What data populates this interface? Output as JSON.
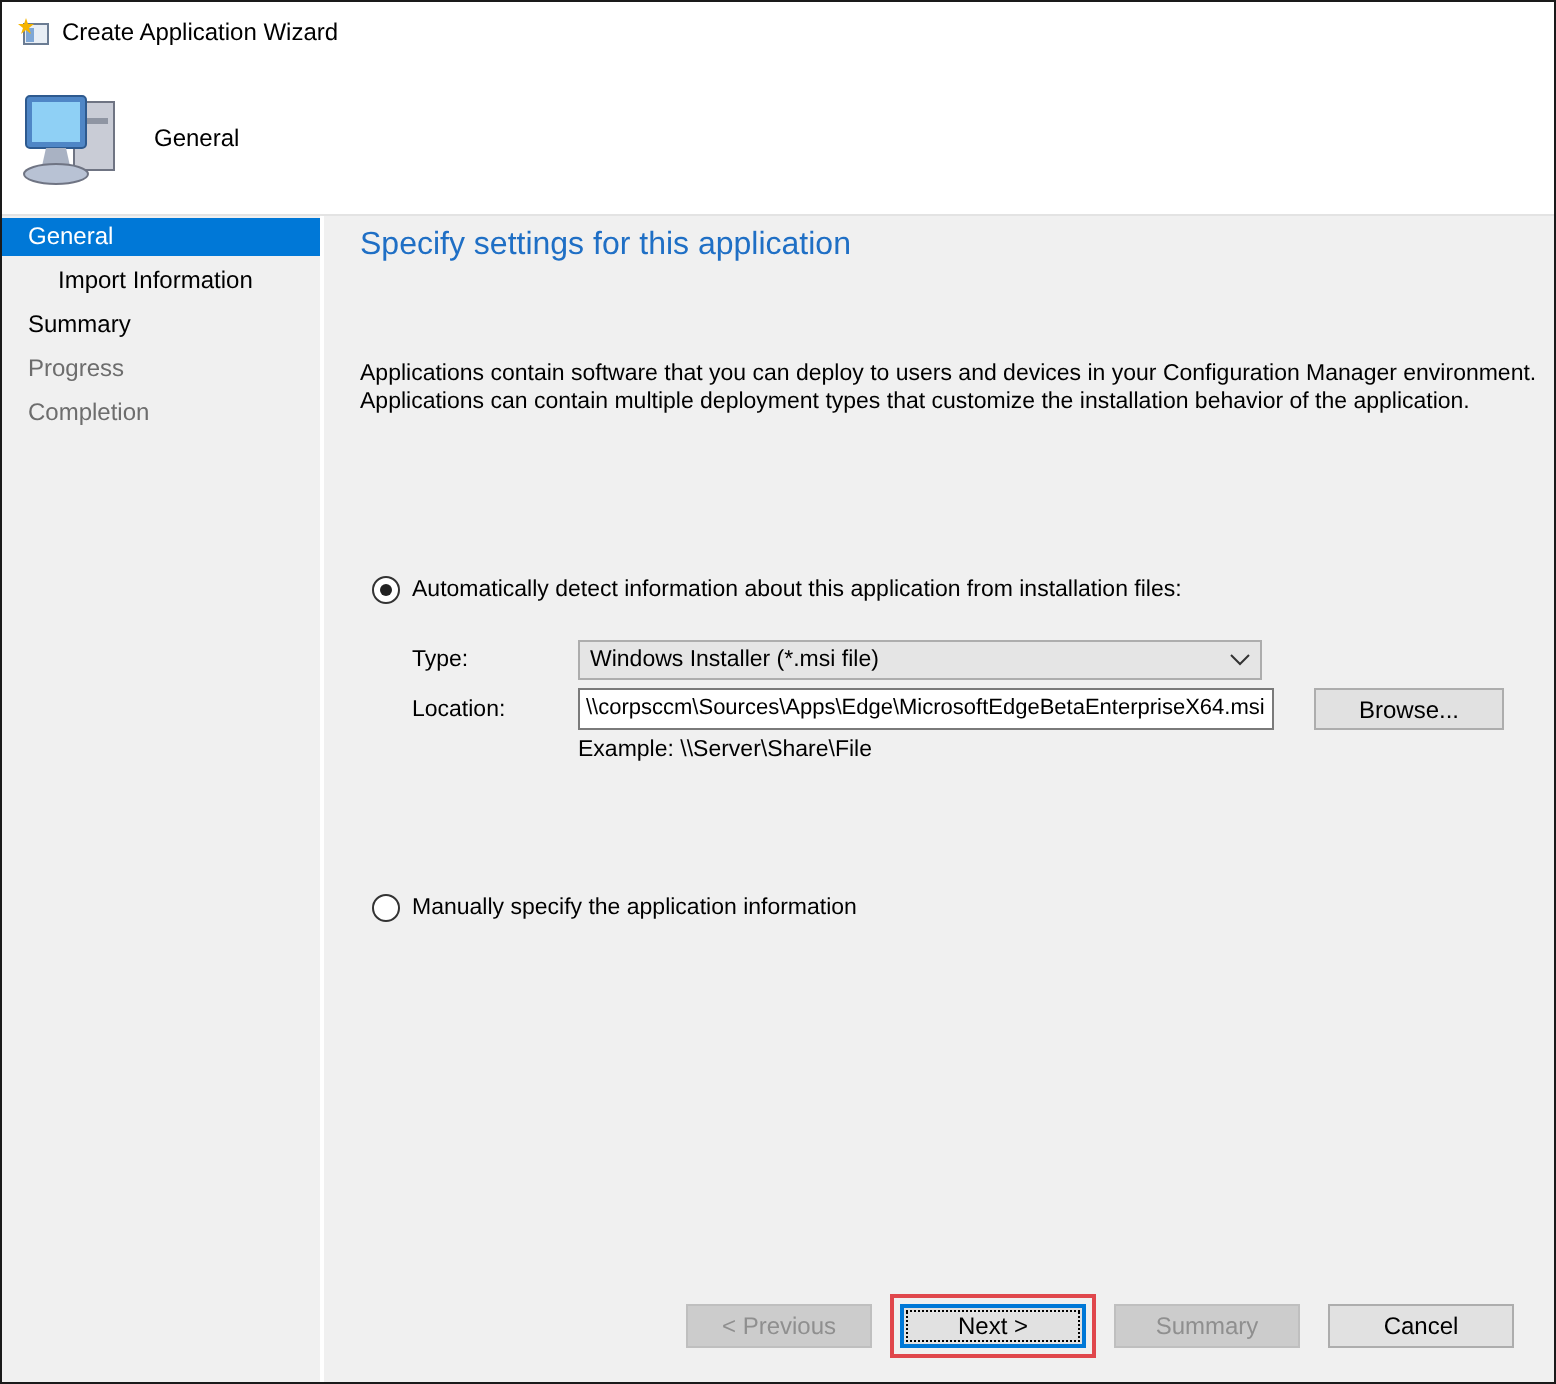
{
  "window": {
    "title": "Create Application Wizard"
  },
  "header": {
    "title": "General"
  },
  "steps": [
    {
      "label": "General",
      "selected": true,
      "disabled": false,
      "children": [
        {
          "label": "Import Information",
          "selected": false,
          "disabled": false
        }
      ]
    },
    {
      "label": "Summary",
      "selected": false,
      "disabled": false
    },
    {
      "label": "Progress",
      "selected": false,
      "disabled": true
    },
    {
      "label": "Completion",
      "selected": false,
      "disabled": true
    }
  ],
  "page": {
    "heading": "Specify settings for this application",
    "description": [
      "Applications contain software that you can deploy to users and devices in your Configuration Manager environment.",
      "Applications can contain multiple deployment types that customize the installation behavior of the application."
    ]
  },
  "options": [
    {
      "label": "Automatically detect information about this application from installation files:",
      "selected": true
    },
    {
      "label": "Manually specify the application information",
      "selected": false
    }
  ],
  "type_field": {
    "label": "Type:",
    "value": "Windows Installer (*.msi file)"
  },
  "location_field": {
    "label": "Location:",
    "value": "\\\\corpsccm\\Sources\\Apps\\Edge\\MicrosoftEdgeBetaEnterpriseX64.msi",
    "hint": "Example: \\\\Server\\Share\\File"
  },
  "browse_button": "Browse...",
  "buttons": [
    {
      "label": "< Previous",
      "disabled": true,
      "focused": false,
      "highlighted": false
    },
    {
      "label": "Next >",
      "disabled": false,
      "focused": true,
      "highlighted": true
    },
    {
      "label": "Summary",
      "disabled": true,
      "focused": false,
      "highlighted": false
    },
    {
      "label": "Cancel",
      "disabled": false,
      "focused": false,
      "highlighted": false
    }
  ]
}
